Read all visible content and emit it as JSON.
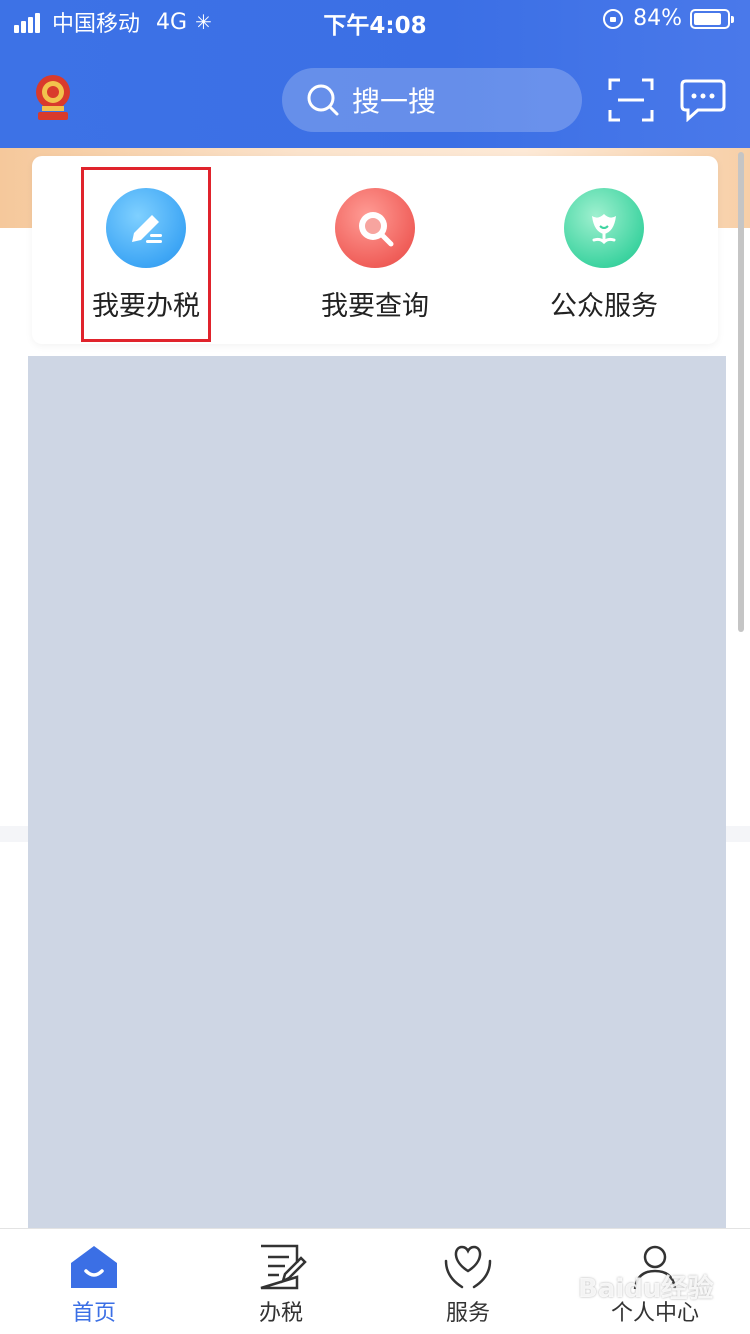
{
  "status_bar": {
    "carrier": "中国移动",
    "network": "4G",
    "time": "下午4:08",
    "battery": "84%",
    "battery_level": 0.84
  },
  "top_bar": {
    "search_placeholder": "搜一搜",
    "icons": [
      "emblem-logo",
      "scan-icon",
      "message-icon"
    ]
  },
  "quick_access": {
    "items": [
      {
        "label": "我要办税",
        "icon": "pencil-icon",
        "color": "#3ea6f5"
      },
      {
        "label": "我要查询",
        "icon": "search-icon",
        "color": "#f05f5a"
      },
      {
        "label": "公众服务",
        "icon": "flower-icon",
        "color": "#3fd4a1"
      }
    ]
  },
  "tab_bar": {
    "tabs": [
      {
        "label": "首页",
        "icon": "home-icon",
        "active": true
      },
      {
        "label": "办税",
        "icon": "document-icon",
        "active": false
      },
      {
        "label": "服务",
        "icon": "heart-hands-icon",
        "active": false
      },
      {
        "label": "个人中心",
        "icon": "person-icon",
        "active": false
      }
    ]
  },
  "watermark": {
    "text": "Baidu经验"
  },
  "colors": {
    "primary": "#3b6fe5",
    "highlight": "#e0232c",
    "placeholder": "#ced6e4"
  }
}
